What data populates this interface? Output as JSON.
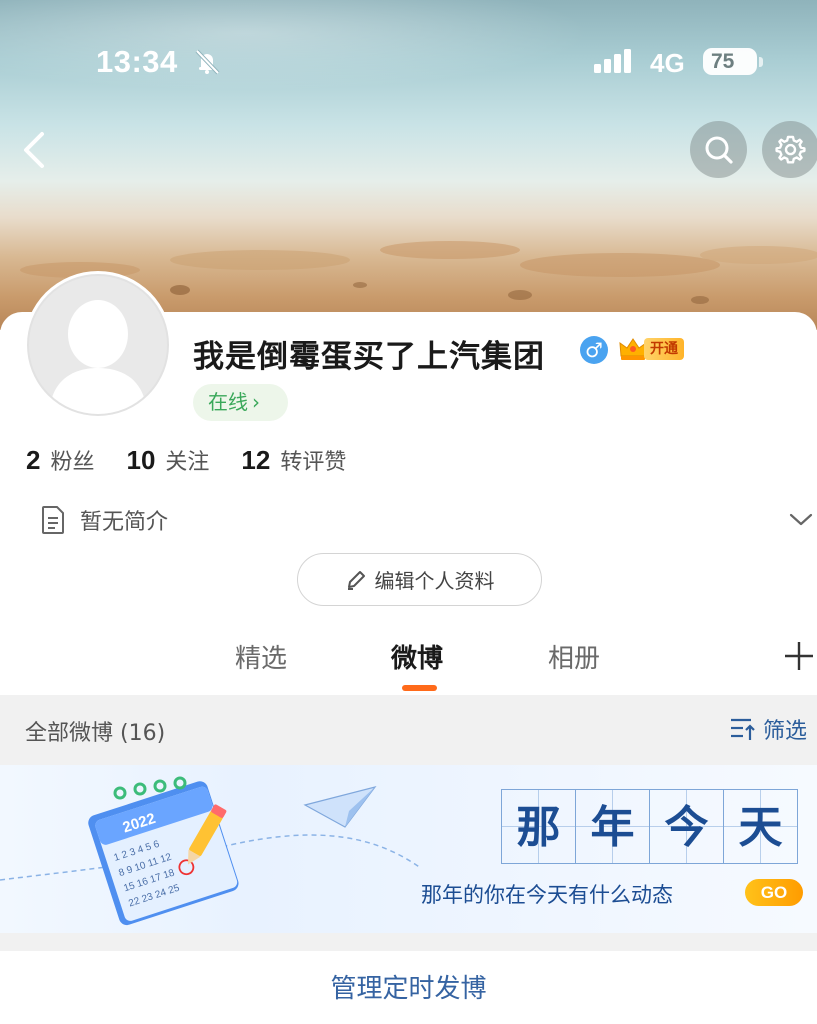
{
  "status_bar": {
    "time": "13:34",
    "network": "4G",
    "battery": "75"
  },
  "profile": {
    "username": "我是倒霉蛋买了上汽集团",
    "gender_symbol": "♂",
    "vip_label": "开通",
    "online_label": "在线",
    "online_chevron": "›",
    "stats": [
      {
        "value": "2",
        "label": "粉丝"
      },
      {
        "value": "10",
        "label": "关注"
      },
      {
        "value": "12",
        "label": "转评赞"
      }
    ],
    "bio": "暂无简介",
    "edit_button": "编辑个人资料"
  },
  "tabs": [
    {
      "label": "精选",
      "active": false
    },
    {
      "label": "微博",
      "active": true
    },
    {
      "label": "相册",
      "active": false
    }
  ],
  "feed": {
    "count_label": "全部微博 (16)",
    "filter_label": "筛选"
  },
  "memory_banner": {
    "title_chars": [
      "那",
      "年",
      "今",
      "天"
    ],
    "subtitle": "那年的你在今天有什么动态",
    "go_label": "GO",
    "calendar_year": "2022"
  },
  "manage_label": "管理定时发博",
  "colors": {
    "accent_orange": "#ff6a1a",
    "link_blue": "#3563a2",
    "online_green": "#3aa85a",
    "gender_blue": "#4aa3f0"
  },
  "icons": {
    "back": "chevron-left-icon",
    "search": "search-icon",
    "settings": "gear-icon",
    "bell_off": "bell-off-icon",
    "bio": "document-icon",
    "expand": "chevron-down-icon",
    "edit": "pencil-icon",
    "add": "plus-icon",
    "filter": "sort-filter-icon"
  }
}
